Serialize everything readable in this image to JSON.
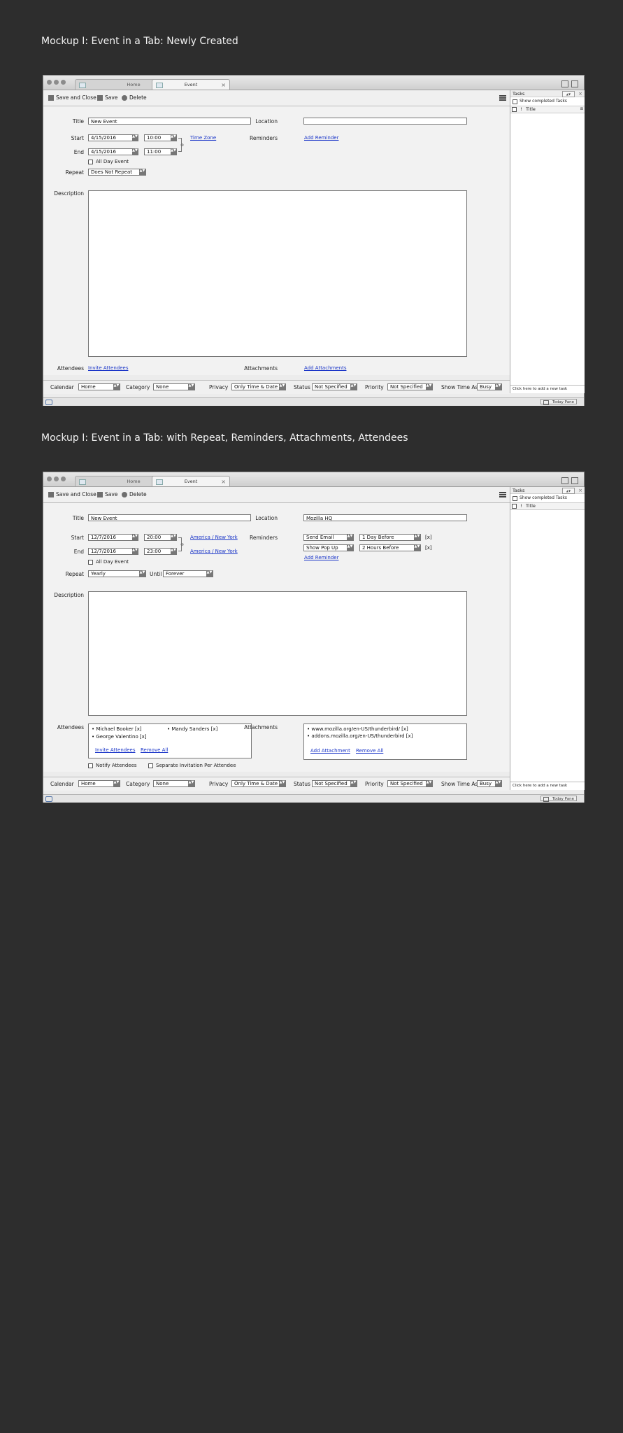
{
  "mockups": [
    {
      "heading": "Mockup I:  Event in a Tab:  Newly Created",
      "tabs": {
        "home": "Home",
        "event": "Event"
      },
      "toolbar": {
        "save_close": "Save and Close",
        "save": "Save",
        "delete": "Delete"
      },
      "labels": {
        "title": "Title",
        "location": "Location",
        "start": "Start",
        "end": "End",
        "reminders": "Reminders",
        "repeat": "Repeat",
        "description": "Description",
        "attendees": "Attendees",
        "attachments": "Attachments",
        "all_day": "All Day Event"
      },
      "fields": {
        "title": "New Event",
        "location": "",
        "start_date": "4/15/2016",
        "start_time": "10:00",
        "end_date": "4/15/2016",
        "end_time": "11:00",
        "repeat": "Does Not Repeat"
      },
      "links": {
        "time_zone": "Time Zone",
        "add_reminder": "Add Reminder",
        "invite_attendees": "Invite Attendees",
        "add_attachments": "Add Attachments"
      },
      "bottom": {
        "calendar_label": "Calendar",
        "calendar": "Home",
        "category_label": "Category",
        "category": "None",
        "privacy_label": "Privacy",
        "privacy": "Only Time & Date",
        "status_label": "Status",
        "status": "Not Specified",
        "priority_label": "Priority",
        "priority": "Not Specified",
        "showas_label": "Show Time As",
        "showas": "Busy"
      },
      "pane": {
        "title": "Tasks",
        "show_completed": "Show completed Tasks",
        "col_title": "Title",
        "new_task": "Click here to add a new task"
      },
      "statusbar": {
        "today_pane": "Today Pane"
      }
    },
    {
      "heading": "Mockup I:  Event in a Tab: with Repeat, Reminders, Attachments, Attendees",
      "tabs": {
        "home": "Home",
        "event": "Event"
      },
      "toolbar": {
        "save_close": "Save and Close",
        "save": "Save",
        "delete": "Delete"
      },
      "labels": {
        "title": "Title",
        "location": "Location",
        "start": "Start",
        "end": "End",
        "reminders": "Reminders",
        "repeat": "Repeat",
        "until": "Until",
        "description": "Description",
        "attendees": "Attendees",
        "attachments": "Attachments",
        "all_day": "All Day Event",
        "notify": "Notify Attendees",
        "separate": "Separate Invitation Per Attendee"
      },
      "fields": {
        "title": "New Event",
        "location": "Mozilla HQ",
        "start_date": "12/7/2016",
        "start_time": "20:00",
        "end_date": "12/7/2016",
        "end_time": "23:00",
        "repeat": "Yearly",
        "until": "Forever"
      },
      "links": {
        "start_tz": "America / New York",
        "end_tz": "America / New York",
        "add_reminder": "Add Reminder",
        "invite_attendees": "Invite Attendees",
        "remove_all_attendees": "Remove All",
        "add_attachment": "Add Attachment",
        "remove_all_attachments": "Remove All"
      },
      "reminders": [
        {
          "type": "Send Email",
          "when": "1 Day Before",
          "remove": "[x]"
        },
        {
          "type": "Show Pop Up",
          "when": "2 Hours Before",
          "remove": "[x]"
        }
      ],
      "attendees": [
        "• Michael Booker [x]",
        "• Mandy Sanders [x]",
        "• George Valentino [x]"
      ],
      "attachments": [
        "• www.mozilla.org/en-US/thunderbird/ [x]",
        "• addons.mozilla.org/en-US/thunderbird [x]"
      ],
      "bottom": {
        "calendar_label": "Calendar",
        "calendar": "Home",
        "category_label": "Category",
        "category": "None",
        "privacy_label": "Privacy",
        "privacy": "Only Time & Date",
        "status_label": "Status",
        "status": "Not Specified",
        "priority_label": "Priority",
        "priority": "Not Specified",
        "showas_label": "Show Time As",
        "showas": "Busy"
      },
      "pane": {
        "title": "Tasks",
        "show_completed": "Show completed Tasks",
        "col_title": "Title",
        "new_task": "Click here to add a new task"
      },
      "statusbar": {
        "today_pane": "Today Pane"
      }
    }
  ]
}
